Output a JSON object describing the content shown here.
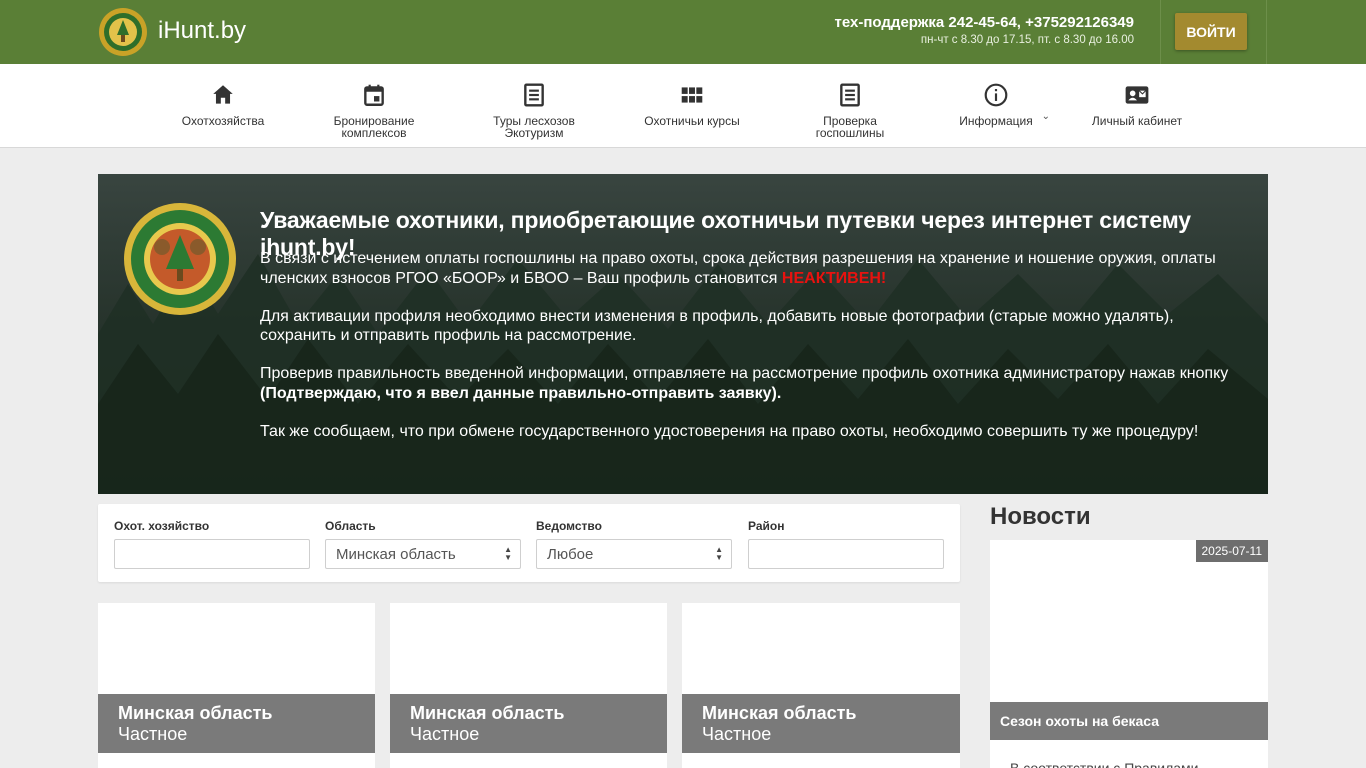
{
  "header": {
    "brand": "iHunt.by",
    "support_phone": "тех-поддержка 242-45-64, +375292126349",
    "support_hours": "пн-чт с 8.30 до 17.15, пт. с 8.30 до 16.00",
    "login_label": "ВОЙТИ",
    "bg_color": "#5a7f36"
  },
  "nav": {
    "items": [
      {
        "icon": "home-icon",
        "label": "Охотхозяйства"
      },
      {
        "icon": "calendar-icon",
        "label1": "Бронирование",
        "label2": "комплексов"
      },
      {
        "icon": "list-icon",
        "label1": "Туры лесхозов",
        "label2": "Экотуризм"
      },
      {
        "icon": "grid-icon",
        "label": "Охотничьи курсы"
      },
      {
        "icon": "document-icon",
        "label1": "Проверка",
        "label2": "госпошлины"
      },
      {
        "icon": "info-icon",
        "label": "Информация"
      },
      {
        "icon": "id-card-icon",
        "label": "Личный кабинет"
      }
    ]
  },
  "banner": {
    "title": "Уважаемые охотники, приобретающие охотничьи путевки через интернет систему ihunt.by!",
    "p1_text": "В связи с истечением оплаты госпошлины на право охоты, срока действия разрешения на хранение и ношение оружия, оплаты членских взносов РГОО «БООР» и БВОО – Ваш профиль становится ",
    "p1_highlight": "НЕАКТИВЕН!",
    "p2": "Для активации профиля необходимо внести изменения в профиль, добавить новые фотографии (старые можно удалять), сохранить и отправить профиль на рассмотрение.",
    "p3_text": "Проверив правильность введенной информации, отправляете на рассмотрение профиль охотника администратору нажав кнопку ",
    "p3_bold": "(Подтверждаю, что я ввел данные правильно-отправить заявку).",
    "p4": "Так же сообщаем, что при обмене государственного удостоверения на право охоты, необходимо совершить ту же процедуру!",
    "highlight_color": "#e8120f"
  },
  "filter": {
    "farm_label": "Охот. хозяйство",
    "farm_value": "",
    "region_label": "Область",
    "region_value": "Минская область",
    "dept_label": "Ведомство",
    "dept_value": "Любое",
    "district_label": "Район",
    "district_value": ""
  },
  "cards": [
    {
      "region": "Минская область",
      "type": "Частное"
    },
    {
      "region": "Минская область",
      "type": "Частное"
    },
    {
      "region": "Минская область",
      "type": "Частное"
    }
  ],
  "news": {
    "title": "Новости",
    "items": [
      {
        "date": "2025-07-11",
        "caption": "Сезон охоты на бекаса",
        "snippet": "В соответствии с Правилами"
      }
    ]
  }
}
